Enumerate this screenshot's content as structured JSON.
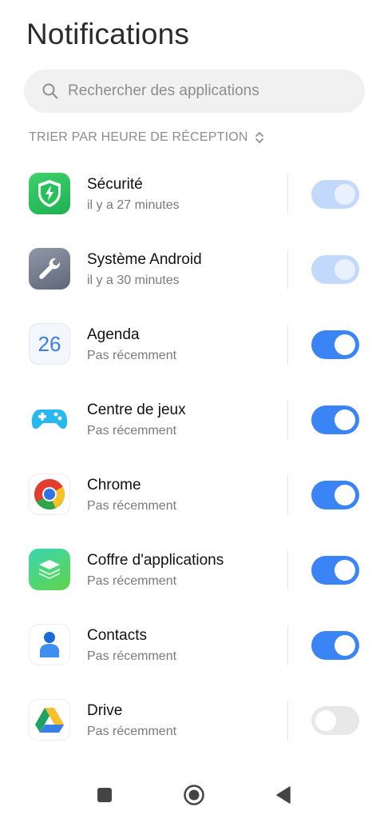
{
  "header": {
    "title": "Notifications"
  },
  "search": {
    "placeholder": "Rechercher des applications"
  },
  "sort": {
    "label": "TRIER PAR HEURE DE RÉCEPTION"
  },
  "apps": [
    {
      "name": "Sécurité",
      "time": "il y a 27 minutes",
      "icon": "security-shield-icon",
      "toggle": "on-disabled"
    },
    {
      "name": "Système Android",
      "time": "il y a 30 minutes",
      "icon": "wrench-settings-icon",
      "toggle": "on-disabled"
    },
    {
      "name": "Agenda",
      "time": "Pas récemment",
      "icon": "calendar-icon",
      "icon_text": "26",
      "toggle": "on"
    },
    {
      "name": "Centre de jeux",
      "time": "Pas récemment",
      "icon": "gamepad-icon",
      "toggle": "on"
    },
    {
      "name": "Chrome",
      "time": "Pas récemment",
      "icon": "chrome-icon",
      "toggle": "on"
    },
    {
      "name": "Coffre d'applications",
      "time": "Pas récemment",
      "icon": "app-vault-icon",
      "toggle": "on"
    },
    {
      "name": "Contacts",
      "time": "Pas récemment",
      "icon": "contacts-icon",
      "toggle": "on"
    },
    {
      "name": "Drive",
      "time": "Pas récemment",
      "icon": "drive-icon",
      "toggle": "off"
    }
  ],
  "navbar": {
    "buttons": [
      "recents-square-icon",
      "home-circle-icon",
      "back-triangle-icon"
    ]
  },
  "colors": {
    "accent": "#3a84f5",
    "accent_disabled": "#c3d9fc",
    "toggle_off": "#e8e8e8"
  }
}
